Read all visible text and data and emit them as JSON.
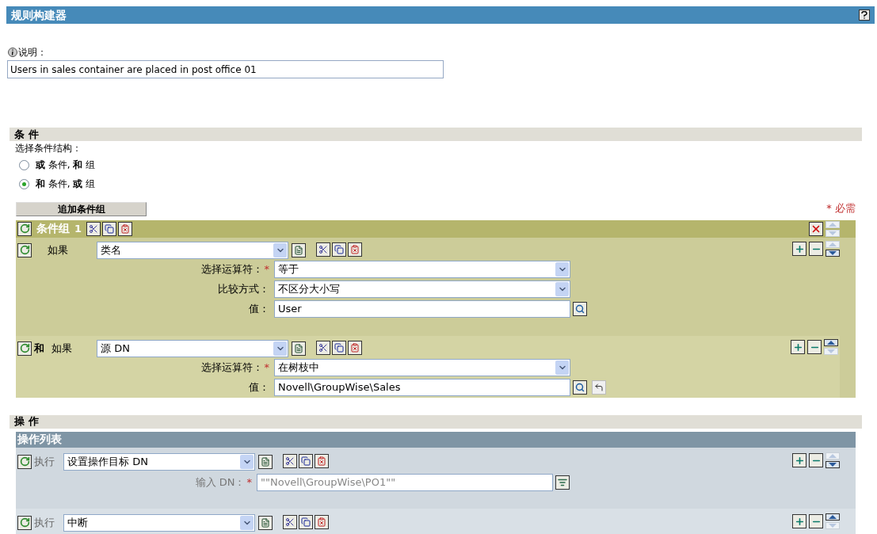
{
  "title": "规则构建器",
  "required_mark": "*",
  "description": {
    "label": "说明：",
    "value": "Users in sales container are placed in post office 01"
  },
  "conditions": {
    "heading": "条 件",
    "structure_label": "选择条件结构：",
    "options": [
      {
        "label": "**或** 条件, **和** 组",
        "selected": false
      },
      {
        "label": "**和** 条件, **或** 组",
        "selected": true
      }
    ],
    "add_group_button": "追加条件组",
    "required_note": "* 必需",
    "group": {
      "label": "条件组",
      "number": "1",
      "move_up": false,
      "move_down": false,
      "items": [
        {
          "if_label": "如果",
          "selector": "类名",
          "move_up": false,
          "move_down": true,
          "fields": [
            {
              "kind": "select",
              "label": "选择运算符：",
              "required": true,
              "value": "等于"
            },
            {
              "kind": "select",
              "label": "比较方式：",
              "required": false,
              "value": "不区分大小写"
            },
            {
              "kind": "value",
              "label": "值：",
              "required": false,
              "value": "User"
            }
          ]
        },
        {
          "connector": "和",
          "if_label": "如果",
          "selector": "源 DN",
          "move_up": true,
          "move_down": false,
          "fields": [
            {
              "kind": "select",
              "label": "选择运算符：",
              "required": true,
              "value": "在树枝中"
            },
            {
              "kind": "dn",
              "label": "值：",
              "required": false,
              "value": "Novell\\GroupWise\\Sales"
            }
          ]
        }
      ]
    }
  },
  "actions": {
    "heading": "操 作",
    "list_title": "操作列表",
    "items": [
      {
        "verb": "执行",
        "selector": "设置操作目标 DN",
        "move_up": false,
        "move_down": true,
        "fields": [
          {
            "kind": "expression",
            "label": "输入 DN：",
            "required": true,
            "value": "\"\"Novell\\GroupWise\\PO1\"\""
          }
        ]
      },
      {
        "verb": "执行",
        "selector": "中断",
        "move_up": true,
        "move_down": false
      }
    ]
  }
}
